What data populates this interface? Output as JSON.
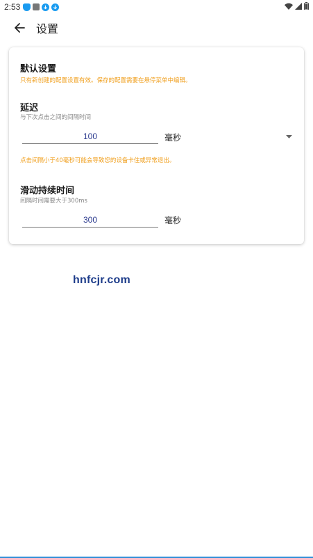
{
  "status_bar": {
    "time": "2:53",
    "notification_icons": [
      "bell-icon",
      "image-icon",
      "download-icon",
      "download-icon"
    ],
    "right_icons": [
      "wifi-icon",
      "signal-icon",
      "battery-icon"
    ]
  },
  "app_bar": {
    "title": "设置"
  },
  "defaults": {
    "title": "默认设置",
    "note": "只有新创建的配置设置有效。保存的配置需要在悬停菜单中编辑。"
  },
  "delay": {
    "title": "延迟",
    "subtitle": "与下次点击之间的间隔时间",
    "value": "100",
    "unit": "毫秒",
    "warning": "点击间隔小于40毫秒可能会导致您的设备卡住或异常退出。"
  },
  "swipe": {
    "title": "滑动持续时间",
    "subtitle": "间隔时间需要大于300ms",
    "value": "300",
    "unit": "毫秒"
  },
  "watermark": "hnfcjr.com",
  "colors": {
    "accent_orange": "#f0a020",
    "value_blue": "#2b3a8e",
    "watermark_blue": "#1d3c8a"
  }
}
